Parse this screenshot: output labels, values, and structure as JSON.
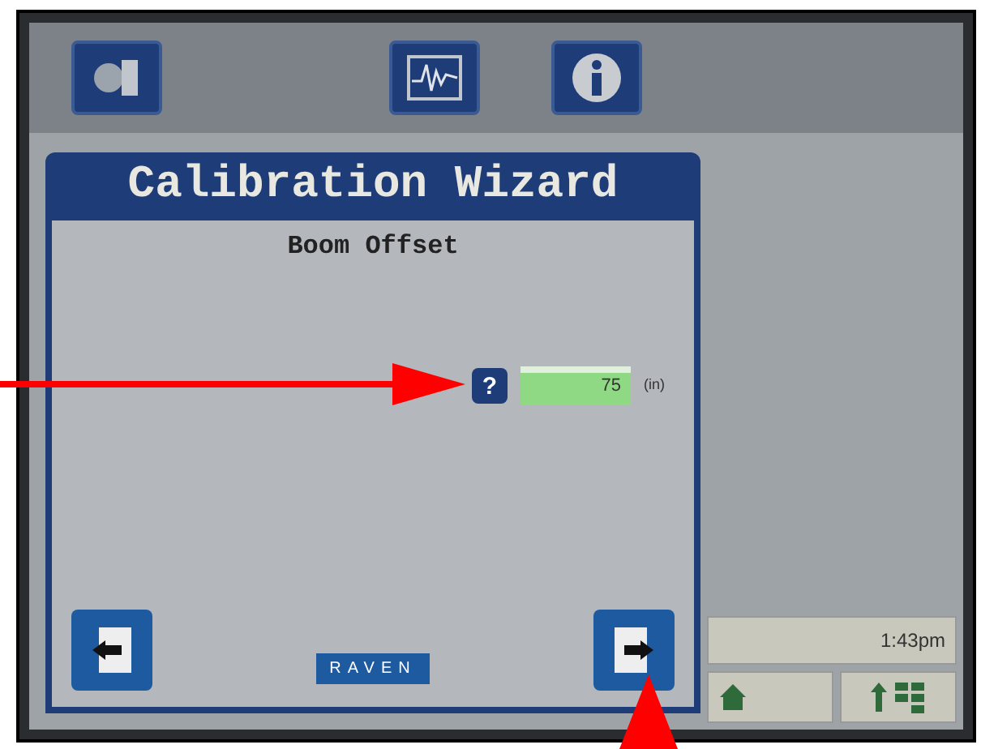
{
  "wizard": {
    "title": "Calibration Wizard",
    "step": "Boom Offset"
  },
  "field": {
    "help": "?",
    "value": "75",
    "unit": "(in)"
  },
  "logo": "RAVEN",
  "status": {
    "time": "1:43pm"
  }
}
